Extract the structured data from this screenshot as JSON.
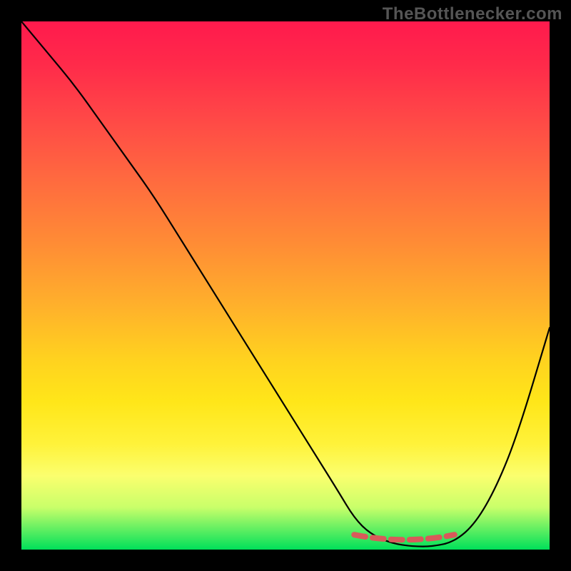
{
  "watermark": "TheBottlenecker.com",
  "colors": {
    "frame_bg": "#000000",
    "gradient_top": "#ff1a4d",
    "gradient_bottom": "#00e05a",
    "curve_stroke": "#000000",
    "valley_marker": "#d85a5a",
    "watermark_text": "#555555"
  },
  "chart_data": {
    "type": "line",
    "title": "",
    "xlabel": "",
    "ylabel": "",
    "xlim": [
      0,
      100
    ],
    "ylim": [
      0,
      100
    ],
    "grid": false,
    "legend": false,
    "series": [
      {
        "name": "bottleneck_curve",
        "x": [
          0,
          5,
          10,
          15,
          20,
          25,
          30,
          35,
          40,
          45,
          50,
          55,
          60,
          63,
          66,
          70,
          74,
          78,
          82,
          86,
          90,
          94,
          100
        ],
        "y": [
          100,
          94,
          88,
          81,
          74,
          67,
          59,
          51,
          43,
          35,
          27,
          19,
          11,
          6,
          3,
          1.2,
          0.6,
          0.6,
          1.5,
          5,
          12,
          22,
          42
        ]
      }
    ],
    "annotations": [
      {
        "name": "optimal_region_marker",
        "kind": "segment_dashed",
        "x_range": [
          63,
          82
        ],
        "y_approx": 2,
        "color": "#d85a5a"
      }
    ],
    "notes": "Axes have no visible tick labels; values are estimated on a 0–100 normalized scale from gradient position and curve geometry. y=100 is top (red), y=0 is bottom (green)."
  }
}
